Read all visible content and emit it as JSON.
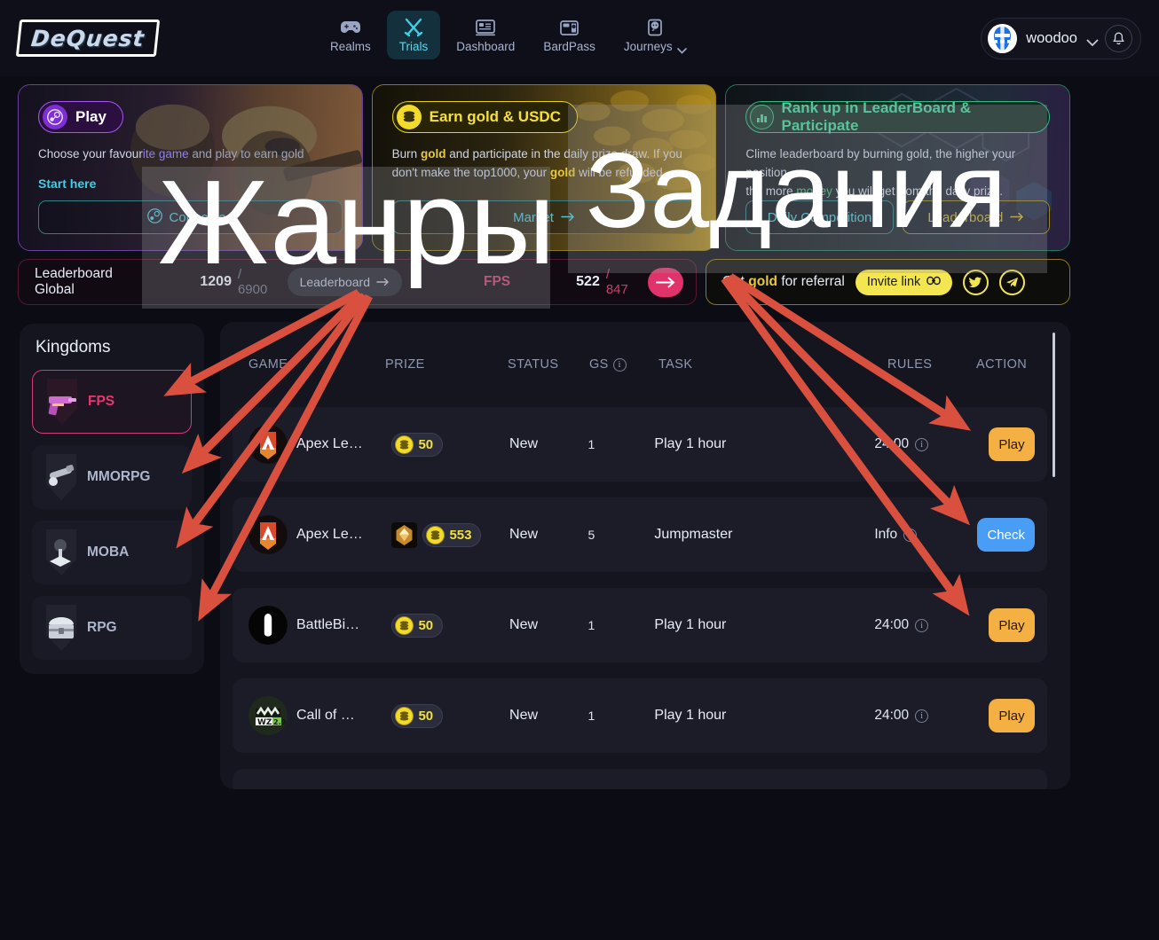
{
  "header": {
    "logo_text": "DeQuest",
    "nav": [
      {
        "label": "Realms",
        "icon": "gamepad-icon",
        "active": false,
        "has_chevron": false
      },
      {
        "label": "Trials",
        "icon": "swords-icon",
        "active": true,
        "has_chevron": false
      },
      {
        "label": "Dashboard",
        "icon": "dashboard-icon",
        "active": false,
        "has_chevron": false
      },
      {
        "label": "BardPass",
        "icon": "card-icon",
        "active": false,
        "has_chevron": false
      },
      {
        "label": "Journeys",
        "icon": "chat-icon",
        "active": false,
        "has_chevron": true
      }
    ],
    "username": "woodoo",
    "notification_icon": "bell-icon",
    "account_chevron": "chevron-down-icon"
  },
  "banners": [
    {
      "id": "play",
      "title": "Play",
      "icon": "steam-icon",
      "desc_prefix": "Choose your favour",
      "desc_mid": "ite game",
      "desc_suffix": " and play to earn gold ",
      "subtitle": "Start here",
      "button": "Connected",
      "button_icon": "steam-icon",
      "accent": "#a855f7"
    },
    {
      "id": "earn",
      "title": "Earn gold & USDC",
      "icon": "coins-icon",
      "desc_line1_a": "Burn ",
      "desc_line1_gold": "gold",
      "desc_line1_b": " and participate in the daily prize draw. If you",
      "desc_line2_a": "don't make the top1000, your ",
      "desc_line2_gold": "gold",
      "desc_line2_b": " will be refunded",
      "button": "Market",
      "accent": "#f3db2c"
    },
    {
      "id": "rank",
      "title": "Rank up in LeaderBoard & Participate",
      "icon": "chart-bars-icon",
      "desc_line1": "Clime leaderboard by burning gold, the higher your position",
      "desc_line2_a": "the more ",
      "desc_line2_money": "money",
      "desc_line2_b": " you will get from the daily priz...",
      "button_left": "Daily Competition",
      "button_right": "Leaderboard",
      "accent": "#2fbd83"
    }
  ],
  "stats": {
    "leaderboard_label": "Leaderboard Global",
    "global_rank": "1209",
    "global_total": "/ 6900",
    "leaderboard_button": "Leaderboard",
    "leaderboard_button_icon": "arrow-right-icon",
    "genre_tag": "FPS",
    "genre_rank": "522",
    "genre_total": "/ 847",
    "genre_arrow_icon": "arrow-right-icon",
    "referral_a": "Get ",
    "referral_gold": "gold",
    "referral_b": " for referral",
    "invite_label": "Invite link",
    "invite_icon": "link-icon",
    "social": [
      {
        "name": "twitter-icon"
      },
      {
        "name": "telegram-icon"
      }
    ]
  },
  "kingdoms": {
    "title": "Kingdoms",
    "items": [
      {
        "label": "FPS",
        "icon": "pistol-icon",
        "active": true
      },
      {
        "label": "MMORPG",
        "icon": "staff-icon",
        "active": false
      },
      {
        "label": "MOBA",
        "icon": "joystick-icon",
        "active": false
      },
      {
        "label": "RPG",
        "icon": "chest-icon",
        "active": false
      }
    ]
  },
  "table": {
    "columns": [
      "GAME",
      "PRIZE",
      "STATUS",
      "GS",
      "TASK",
      "RULES",
      "ACTION"
    ],
    "gs_info_icon": "info-icon",
    "rows": [
      {
        "game": "Apex Le…",
        "game_logo": "apex-legends-logo",
        "prize": "50",
        "prize_badge": null,
        "status": "New",
        "gs": "1",
        "task": "Play 1 hour",
        "rules": "24:00",
        "rules_icon": "info-icon",
        "action": "Play",
        "action_type": "play"
      },
      {
        "game": "Apex Le…",
        "game_logo": "apex-legends-logo",
        "prize": "553",
        "prize_badge": "badge-icon",
        "status": "New",
        "gs": "5",
        "task": "Jumpmaster",
        "rules": "Info",
        "rules_icon": "info-icon",
        "action": "Check",
        "action_type": "check"
      },
      {
        "game": "BattleBi…",
        "game_logo": "battlebit-logo",
        "prize": "50",
        "prize_badge": null,
        "status": "New",
        "gs": "1",
        "task": "Play 1 hour",
        "rules": "24:00",
        "rules_icon": "info-icon",
        "action": "Play",
        "action_type": "play"
      },
      {
        "game": "Call of …",
        "game_logo": "call-of-duty-mwz-logo",
        "prize": "50",
        "prize_badge": null,
        "status": "New",
        "gs": "1",
        "task": "Play 1 hour",
        "rules": "24:00",
        "rules_icon": "info-icon",
        "action": "Play",
        "action_type": "play"
      }
    ]
  },
  "annotations": {
    "genres_label": "Жанры",
    "tasks_label": "Задания",
    "arrow_color": "#d9503f"
  }
}
